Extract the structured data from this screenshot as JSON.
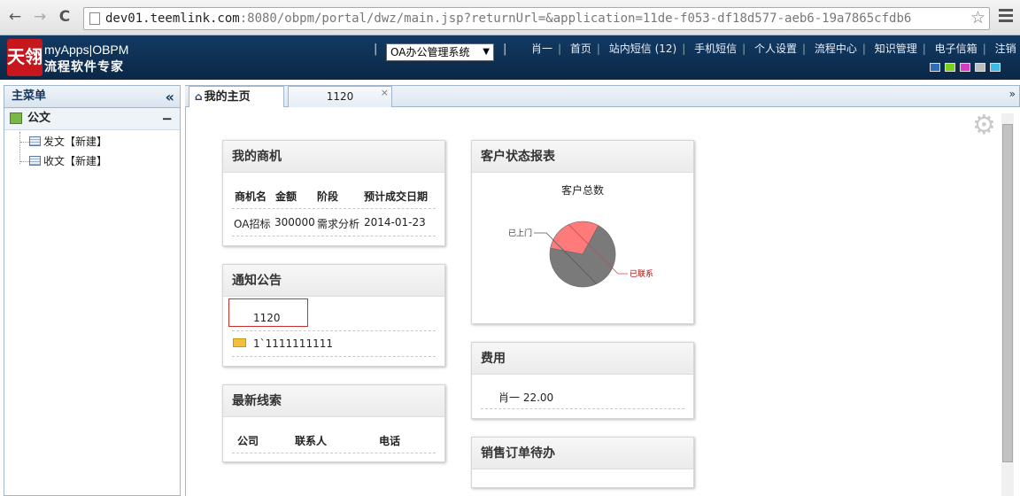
{
  "browser": {
    "url_host": "dev01.teemlink.com",
    "url_rest": ":8080/obpm/portal/dwz/main.jsp?returnUrl=&application=11de-f053-df18d577-aeb6-19a7865cfdb6",
    "back": "←",
    "forward": "→",
    "reload": "C",
    "star": "☆"
  },
  "header": {
    "logo_text": "天翎",
    "brand_line1": "myApps|OBPM",
    "brand_line2": "流程软件专家",
    "system_select": "OA办公管理系统",
    "select_arrow": "▼",
    "nav": [
      "肖一",
      "首页",
      "站内短信 (12)",
      "手机短信",
      "个人设置",
      "流程中心",
      "知识管理",
      "电子信箱",
      "注销"
    ],
    "theme_colors": [
      "#2f6db5",
      "#7ccf1c",
      "#d93cc2",
      "#bdbdbd",
      "#3fb9e8"
    ]
  },
  "sidebar": {
    "title": "主菜单",
    "collapse": "«",
    "group": "公文",
    "group_toggle": "−",
    "items": [
      "发文【新建】",
      "收文【新建】"
    ]
  },
  "tabs": {
    "home_label": "我的主页",
    "home_icon": "⌂",
    "second_label": "1120",
    "close": "×",
    "more": "»"
  },
  "portlets": {
    "opportunities": {
      "title": "我的商机",
      "headers": [
        "商机名",
        "金额",
        "阶段",
        "预计成交日期"
      ],
      "rows": [
        [
          "OA招标",
          "300000",
          "需求分析",
          "2014-01-23"
        ]
      ]
    },
    "notices": {
      "title": "通知公告",
      "items": [
        "1120",
        "1`1111111111"
      ]
    },
    "leads": {
      "title": "最新线索",
      "headers": [
        "公司",
        "联系人",
        "电话"
      ]
    },
    "customer_report": {
      "title": "客户状态报表",
      "chart_title": "客户总数"
    },
    "expenses": {
      "title": "费用",
      "items": [
        "肖一 22.00"
      ]
    },
    "sales_orders": {
      "title": "销售订单待办"
    }
  },
  "chart_data": {
    "type": "pie",
    "title": "客户总数",
    "categories": [
      "已上门",
      "已联系"
    ],
    "values": [
      70,
      30
    ],
    "colors": [
      "#7a7a7a",
      "#ff7b7b"
    ]
  }
}
